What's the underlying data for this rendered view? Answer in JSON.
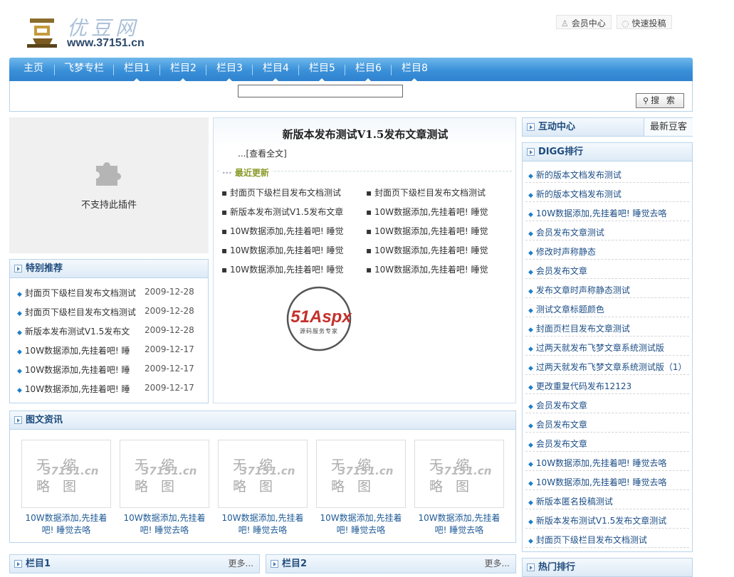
{
  "header": {
    "logo_cn": "优豆网",
    "logo_url": "www.37151.cn",
    "member_center": "会员中心",
    "submit": "快速投稿"
  },
  "nav": [
    "主页",
    "飞梦专栏",
    "栏目1",
    "栏目2",
    "栏目3",
    "栏目4",
    "栏目5",
    "栏目6",
    "栏目8"
  ],
  "search": {
    "value": "",
    "button": "搜 索"
  },
  "plugin": {
    "text": "不支持此插件"
  },
  "featured": {
    "title": "特别推荐",
    "items": [
      {
        "title": "封面页下级栏目发布文档测试",
        "date": "2009-12-28"
      },
      {
        "title": "封面页下级栏目发布文档测试",
        "date": "2009-12-28"
      },
      {
        "title": "新版本发布测试V1.5发布文",
        "date": "2009-12-28"
      },
      {
        "title": "10W数据添加,先挂着吧! 睡",
        "date": "2009-12-17"
      },
      {
        "title": "10W数据添加,先挂着吧! 睡",
        "date": "2009-12-17"
      },
      {
        "title": "10W数据添加,先挂着吧! 睡",
        "date": "2009-12-17"
      }
    ]
  },
  "headline": {
    "title": "新版本发布测试V1.5发布文章测试",
    "more": "...[查看全文]"
  },
  "latest": {
    "title": "最近更新",
    "col1": [
      "封面页下级栏目发布文档测试",
      "新版本发布测试V1.5发布文章",
      "10W数据添加,先挂着吧! 睡觉",
      "10W数据添加,先挂着吧! 睡觉",
      "10W数据添加,先挂着吧! 睡觉"
    ],
    "col2": [
      "封面页下级栏目发布文档测试",
      "10W数据添加,先挂着吧! 睡觉",
      "10W数据添加,先挂着吧! 睡觉",
      "10W数据添加,先挂着吧! 睡觉",
      "10W数据添加,先挂着吧! 睡觉"
    ]
  },
  "ad": {
    "brand": "51Aspx",
    "tag": "源码服务专家"
  },
  "gallery": {
    "title": "图文资讯",
    "placeholder_line1": "无缩",
    "placeholder_line2": "略图",
    "watermark": "37151.cn",
    "items": [
      "10W数据添加,先挂着吧! 睡觉去咯",
      "10W数据添加,先挂着吧! 睡觉去咯",
      "10W数据添加,先挂着吧! 睡觉去咯",
      "10W数据添加,先挂着吧! 睡觉去咯",
      "10W数据添加,先挂着吧! 睡觉去咯"
    ]
  },
  "interactive": {
    "title": "互动中心",
    "tab": "最新豆客"
  },
  "digg": {
    "title": "DIGG排行",
    "items": [
      "新的版本文档发布测试",
      "新的版本文档发布测试",
      "10W数据添加,先挂着吧! 睡觉去咯",
      "会员发布文章测试",
      "修改时声称静态",
      "会员发布文章",
      "发布文章时声称静态测试",
      "测试文章标题颜色",
      "封面页栏目发布文章测试",
      "过两天就发布飞梦文章系统测试版",
      "过两天就发布飞梦文章系统测试版（1）",
      "更改重复代码发布12123",
      "会员发布文章",
      "会员发布文章",
      "会员发布文章",
      "10W数据添加,先挂着吧! 睡觉去咯",
      "10W数据添加,先挂着吧! 睡觉去咯",
      "新版本匿名投稿测试",
      "新版本发布测试V1.5发布文章测试",
      "封面页下级栏目发布文档测试"
    ]
  },
  "bottom": {
    "col1": "栏目1",
    "col2": "栏目2",
    "more": "更多...",
    "hot": "热门排行"
  }
}
